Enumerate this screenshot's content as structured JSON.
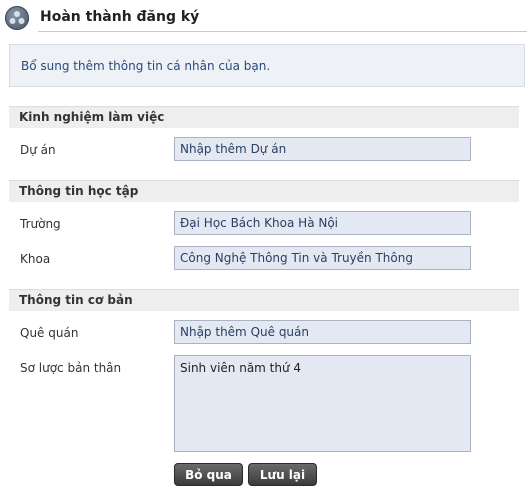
{
  "header": {
    "title": "Hoàn thành đăng ký",
    "logo_icon": "profile-logo-icon"
  },
  "intro_text": "Bổ sung thêm thông tin cá nhân của bạn.",
  "sections": {
    "work": {
      "title": "Kinh nghiệm làm việc",
      "project": {
        "label": "Dự án",
        "value": "Nhập thêm Dự án"
      }
    },
    "education": {
      "title": "Thông tin học tập",
      "school": {
        "label": "Trường",
        "value": "Đại Học Bách Khoa Hà Nội"
      },
      "faculty": {
        "label": "Khoa",
        "value": "Công Nghệ Thông Tin và Truyền Thông"
      }
    },
    "basic": {
      "title": "Thông tin cơ bản",
      "hometown": {
        "label": "Quê quán",
        "value": "Nhập thêm Quê quán"
      },
      "bio": {
        "label": "Sơ lược bản thân",
        "value": "Sinh viên năm thứ 4"
      }
    }
  },
  "buttons": {
    "skip": "Bỏ qua",
    "save": "Lưu lại"
  },
  "colors": {
    "field_bg": "#e3e8f2",
    "intro_text": "#2a4a7b",
    "button_bg": "#4a4a4a"
  }
}
